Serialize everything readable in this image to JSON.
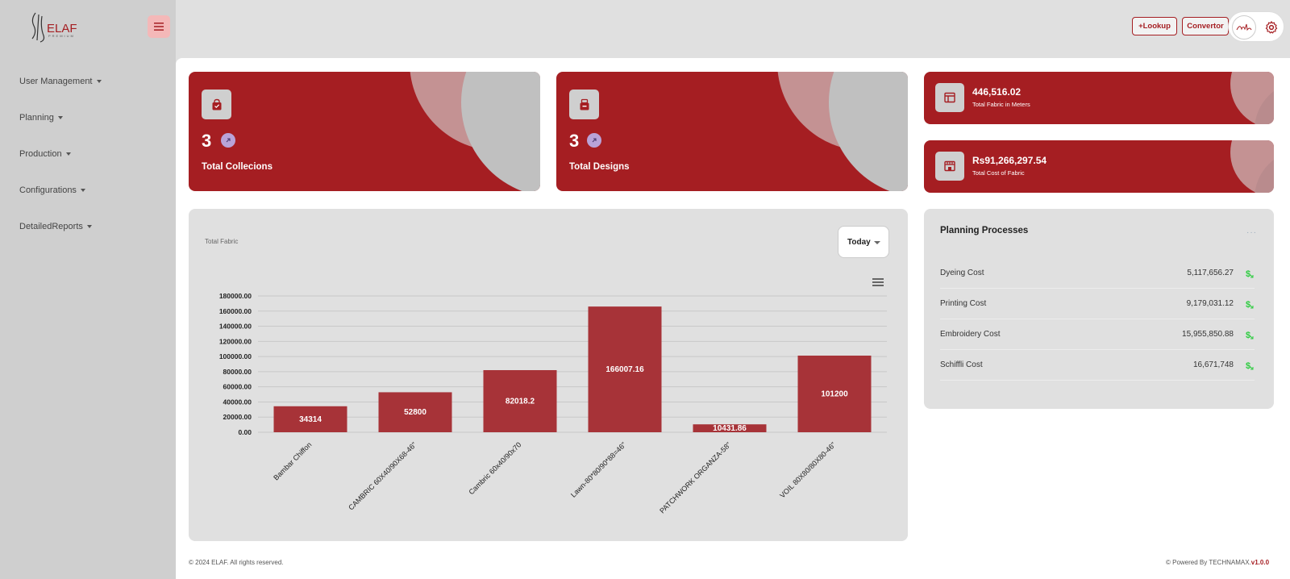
{
  "brand": {
    "name": "ELAF",
    "sub": "PREMIUM"
  },
  "sidebar": {
    "items": [
      {
        "label": "User Management"
      },
      {
        "label": "Planning"
      },
      {
        "label": "Production"
      },
      {
        "label": "Configurations"
      },
      {
        "label": "DetailedReports"
      }
    ]
  },
  "topbar": {
    "lookup_label": "+Lookup",
    "convertor_label": "Convertor"
  },
  "cards": {
    "collections": {
      "value": "3",
      "label": "Total Collecions"
    },
    "designs": {
      "value": "3",
      "label": "Total Designs"
    },
    "fabric_meters": {
      "value": "446,516.02",
      "label": "Total Fabric in Meters"
    },
    "fabric_cost": {
      "value": "Rs91,266,297.54",
      "label": "Total Cost of Fabric"
    }
  },
  "chart_panel": {
    "title": "Total Fabric",
    "period": "Today"
  },
  "chart_data": {
    "type": "bar",
    "title": "Total Fabric",
    "categories": [
      "Bambar Chiffon",
      "CAMBRIC 60X40/90X68-46\"",
      "Cambric 60x40/90x70",
      "Lawn-80*80/90*88=46\"",
      "PATCHWORK ORGANZA-58\"",
      "VOIL 80X80/80X80-46\""
    ],
    "values": [
      34314,
      52800,
      82018.2,
      166007.16,
      10431.86,
      101200
    ],
    "value_labels": [
      "34314",
      "52800",
      "82018.2",
      "166007.16",
      "10431.86",
      "101200"
    ],
    "yticks": [
      "0.00",
      "20000.00",
      "40000.00",
      "60000.00",
      "80000.00",
      "100000.00",
      "120000.00",
      "140000.00",
      "160000.00",
      "180000.00"
    ],
    "ylim": [
      0,
      180000
    ],
    "grid": true,
    "bar_color": "#a73338"
  },
  "planning": {
    "title": "Planning Processes",
    "menu": "···",
    "rows": [
      {
        "label": "Dyeing Cost",
        "value": "5,117,656.27"
      },
      {
        "label": "Printing Cost",
        "value": "9,179,031.12"
      },
      {
        "label": "Embroidery Cost",
        "value": "15,955,850.88"
      },
      {
        "label": "Schiffli Cost",
        "value": "16,671,748"
      }
    ]
  },
  "footer": {
    "left": "© 2024 ELAF. All rights reserved.",
    "right_prefix": "© Powered By TECHNAMAX.",
    "version": "v1.0.0"
  },
  "colors": {
    "accent": "#a51e22",
    "coin": "#2ecc40"
  }
}
